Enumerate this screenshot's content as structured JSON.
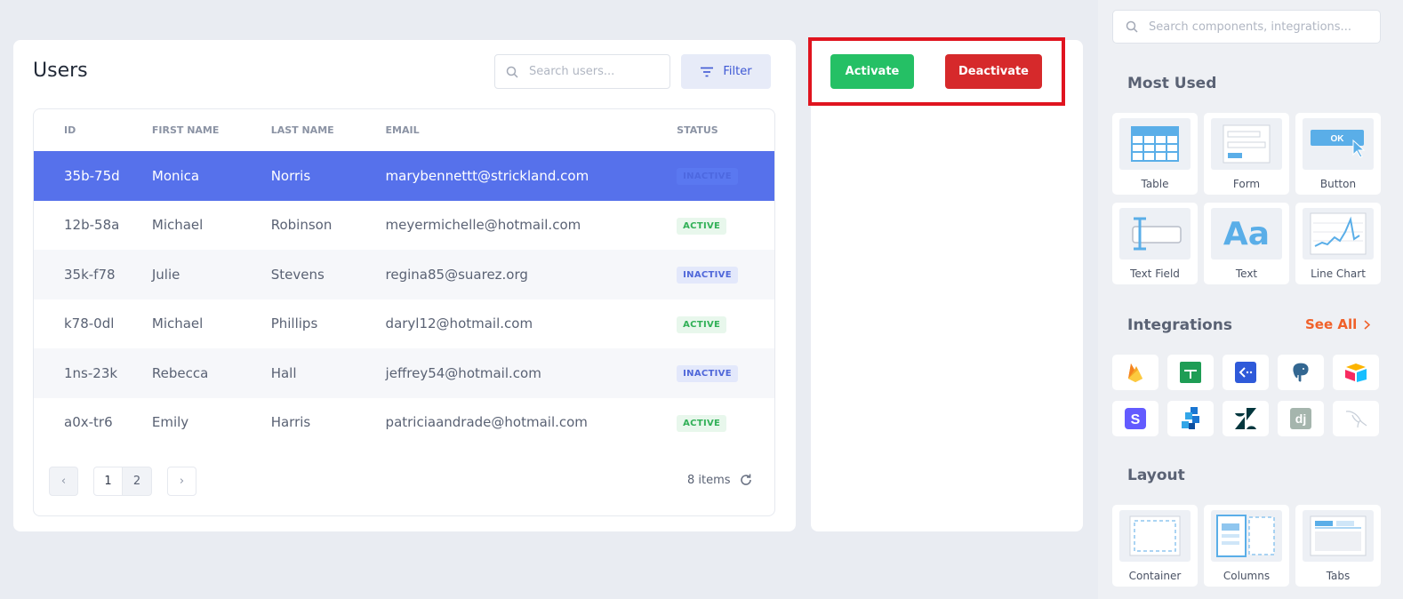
{
  "users": {
    "title": "Users",
    "search_placeholder": "Search users...",
    "filter_label": "Filter",
    "columns": [
      "ID",
      "FIRST NAME",
      "LAST NAME",
      "EMAIL",
      "STATUS"
    ],
    "rows": [
      {
        "id": "35b-75d",
        "first": "Monica",
        "last": "Norris",
        "email": "marybennettt@strickland.com",
        "status": "INACTIVE"
      },
      {
        "id": "12b-58a",
        "first": "Michael",
        "last": "Robinson",
        "email": "meyermichelle@hotmail.com",
        "status": "ACTIVE"
      },
      {
        "id": "35k-f78",
        "first": "Julie",
        "last": "Stevens",
        "email": "regina85@suarez.org",
        "status": "INACTIVE"
      },
      {
        "id": "k78-0dl",
        "first": "Michael",
        "last": "Phillips",
        "email": "daryl12@hotmail.com",
        "status": "ACTIVE"
      },
      {
        "id": "1ns-23k",
        "first": "Rebecca",
        "last": "Hall",
        "email": "jeffrey54@hotmail.com",
        "status": "INACTIVE"
      },
      {
        "id": "a0x-tr6",
        "first": "Emily",
        "last": "Harris",
        "email": "patriciaandrade@hotmail.com",
        "status": "ACTIVE"
      }
    ],
    "pagination": {
      "prev": "‹",
      "pages": [
        "1",
        "2"
      ],
      "next": "›",
      "items_count": "8 items"
    }
  },
  "actions": {
    "activate_label": "Activate",
    "deactivate_label": "Deactivate",
    "activate_color": "#25c065",
    "deactivate_color": "#d6292b"
  },
  "panel": {
    "search_placeholder": "Search components, integrations...",
    "most_used_title": "Most Used",
    "most_used": [
      "Table",
      "Form",
      "Button",
      "Text Field",
      "Text",
      "Line Chart"
    ],
    "button_preview_text": "OK",
    "text_preview_text": "Aa",
    "integrations_title": "Integrations",
    "see_all_label": "See All",
    "integrations": [
      "firebase-icon",
      "google-sheets-icon",
      "rest-api-icon",
      "postgresql-icon",
      "airtable-icon",
      "stripe-icon",
      "n8n-icon",
      "zendesk-icon",
      "django-icon",
      "mysql-icon"
    ],
    "stripe_letter": "S",
    "django_letters": "dj",
    "layout_title": "Layout",
    "layout": [
      "Container",
      "Columns",
      "Tabs"
    ]
  }
}
